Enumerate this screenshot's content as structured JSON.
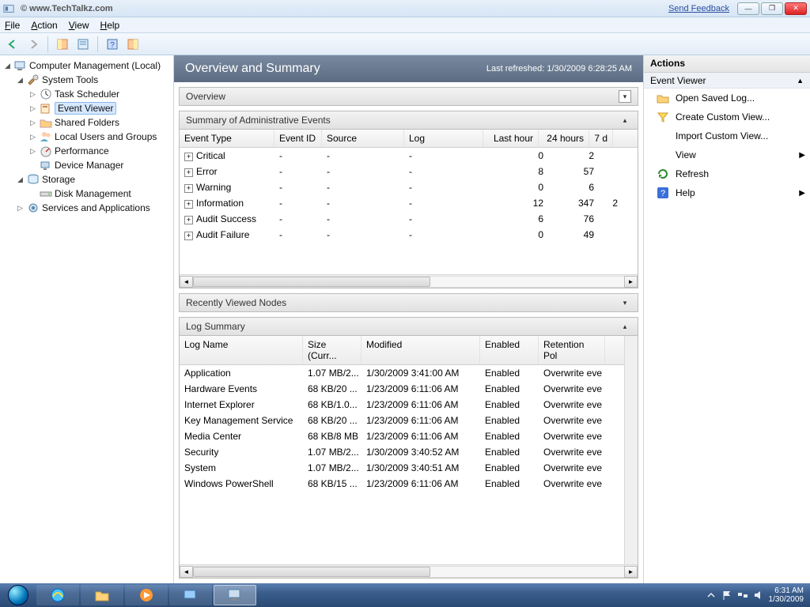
{
  "window": {
    "watermark": "© www.TechTalkz.com",
    "feedback": "Send Feedback"
  },
  "menu": {
    "file": "File",
    "action": "Action",
    "view": "View",
    "help": "Help"
  },
  "tree": {
    "root": "Computer Management (Local)",
    "system_tools": "System Tools",
    "task_scheduler": "Task Scheduler",
    "event_viewer": "Event Viewer",
    "shared_folders": "Shared Folders",
    "local_users": "Local Users and Groups",
    "performance": "Performance",
    "device_manager": "Device Manager",
    "storage": "Storage",
    "disk_management": "Disk Management",
    "services_apps": "Services and Applications"
  },
  "banner": {
    "title": "Overview and Summary",
    "refreshed": "Last refreshed: 1/30/2009 6:28:25 AM"
  },
  "overview_label": "Overview",
  "admin": {
    "title": "Summary of Administrative Events",
    "headers": {
      "type": "Event Type",
      "id": "Event ID",
      "source": "Source",
      "log": "Log",
      "hour": "Last hour",
      "day": "24 hours",
      "week": "7 d"
    },
    "rows": [
      {
        "type": "Critical",
        "id": "-",
        "source": "-",
        "log": "-",
        "hour": "0",
        "day": "2",
        "week": ""
      },
      {
        "type": "Error",
        "id": "-",
        "source": "-",
        "log": "-",
        "hour": "8",
        "day": "57",
        "week": ""
      },
      {
        "type": "Warning",
        "id": "-",
        "source": "-",
        "log": "-",
        "hour": "0",
        "day": "6",
        "week": ""
      },
      {
        "type": "Information",
        "id": "-",
        "source": "-",
        "log": "-",
        "hour": "12",
        "day": "347",
        "week": "2"
      },
      {
        "type": "Audit Success",
        "id": "-",
        "source": "-",
        "log": "-",
        "hour": "6",
        "day": "76",
        "week": ""
      },
      {
        "type": "Audit Failure",
        "id": "-",
        "source": "-",
        "log": "-",
        "hour": "0",
        "day": "49",
        "week": ""
      }
    ]
  },
  "recent_nodes": "Recently Viewed Nodes",
  "logsum": {
    "title": "Log Summary",
    "headers": {
      "name": "Log Name",
      "size": "Size (Curr...",
      "modified": "Modified",
      "enabled": "Enabled",
      "retention": "Retention Pol"
    },
    "rows": [
      {
        "name": "Application",
        "size": "1.07 MB/2...",
        "modified": "1/30/2009 3:41:00 AM",
        "enabled": "Enabled",
        "retention": "Overwrite eve"
      },
      {
        "name": "Hardware Events",
        "size": "68 KB/20 ...",
        "modified": "1/23/2009 6:11:06 AM",
        "enabled": "Enabled",
        "retention": "Overwrite eve"
      },
      {
        "name": "Internet Explorer",
        "size": "68 KB/1.0...",
        "modified": "1/23/2009 6:11:06 AM",
        "enabled": "Enabled",
        "retention": "Overwrite eve"
      },
      {
        "name": "Key Management Service",
        "size": "68 KB/20 ...",
        "modified": "1/23/2009 6:11:06 AM",
        "enabled": "Enabled",
        "retention": "Overwrite eve"
      },
      {
        "name": "Media Center",
        "size": "68 KB/8 MB",
        "modified": "1/23/2009 6:11:06 AM",
        "enabled": "Enabled",
        "retention": "Overwrite eve"
      },
      {
        "name": "Security",
        "size": "1.07 MB/2...",
        "modified": "1/30/2009 3:40:52 AM",
        "enabled": "Enabled",
        "retention": "Overwrite eve"
      },
      {
        "name": "System",
        "size": "1.07 MB/2...",
        "modified": "1/30/2009 3:40:51 AM",
        "enabled": "Enabled",
        "retention": "Overwrite eve"
      },
      {
        "name": "Windows PowerShell",
        "size": "68 KB/15 ...",
        "modified": "1/23/2009 6:11:06 AM",
        "enabled": "Enabled",
        "retention": "Overwrite eve"
      }
    ]
  },
  "actions": {
    "title": "Actions",
    "context": "Event Viewer",
    "open_saved": "Open Saved Log...",
    "create_custom": "Create Custom View...",
    "import_custom": "Import Custom View...",
    "view": "View",
    "refresh": "Refresh",
    "help": "Help"
  },
  "tray": {
    "time": "6:31 AM",
    "date": "1/30/2009"
  }
}
